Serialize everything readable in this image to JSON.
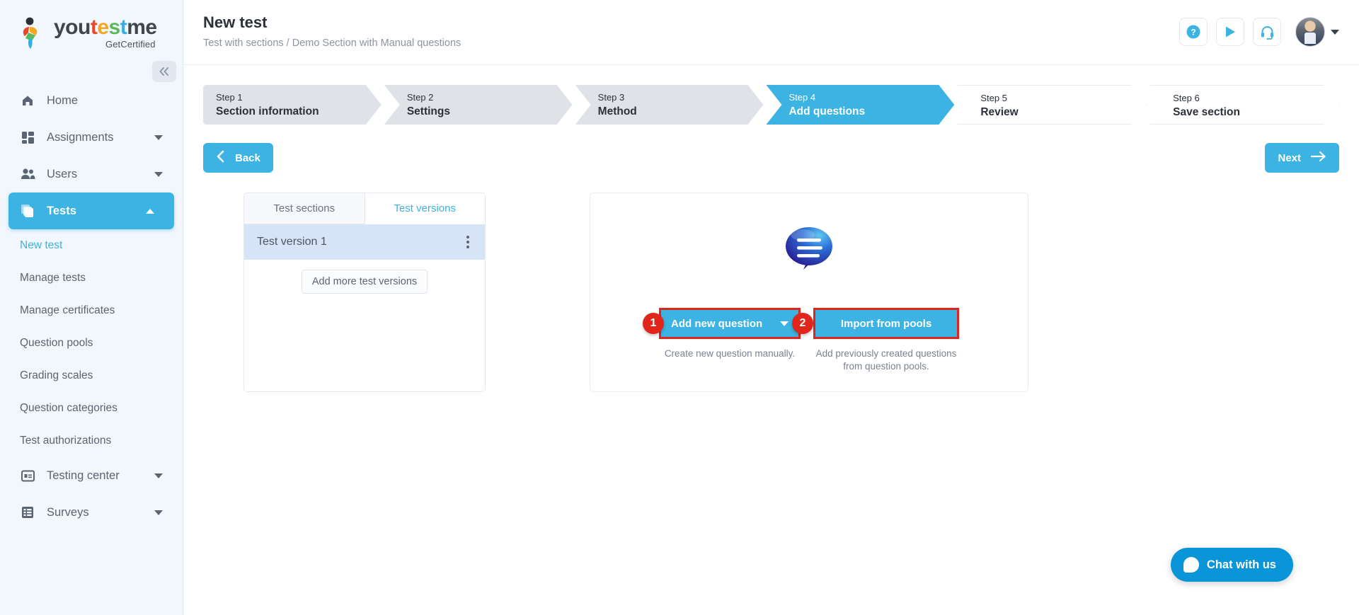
{
  "brand": {
    "name_parts": [
      {
        "t": "you",
        "c": "#3f4650"
      },
      {
        "t": "t",
        "c": "#e8472a"
      },
      {
        "t": "e",
        "c": "#f5a623"
      },
      {
        "t": "s",
        "c": "#5cb85c"
      },
      {
        "t": "t",
        "c": "#35aee0"
      },
      {
        "t": "me",
        "c": "#3f4650"
      }
    ],
    "tagline": "GetCertified",
    "collapse_icon": "chevron-double-left-icon"
  },
  "sidebar": {
    "items": [
      {
        "label": "Home",
        "icon": "home-icon",
        "expandable": false,
        "active": false
      },
      {
        "label": "Assignments",
        "icon": "grid-icon",
        "expandable": true,
        "active": false
      },
      {
        "label": "Users",
        "icon": "users-icon",
        "expandable": true,
        "active": false
      },
      {
        "label": "Tests",
        "icon": "tests-icon",
        "expandable": true,
        "active": true
      }
    ],
    "sub_items": [
      {
        "label": "New test",
        "current": true
      },
      {
        "label": "Manage tests",
        "current": false
      },
      {
        "label": "Manage certificates",
        "current": false
      },
      {
        "label": "Question pools",
        "current": false
      },
      {
        "label": "Grading scales",
        "current": false
      },
      {
        "label": "Question categories",
        "current": false
      },
      {
        "label": "Test authorizations",
        "current": false
      }
    ],
    "bottom_items": [
      {
        "label": "Testing center",
        "icon": "testing-center-icon",
        "expandable": true
      },
      {
        "label": "Surveys",
        "icon": "surveys-icon",
        "expandable": true
      }
    ]
  },
  "header": {
    "title": "New test",
    "breadcrumb": "Test with sections / Demo Section with Manual questions",
    "actions": [
      {
        "name": "help-icon",
        "glyph": "?"
      },
      {
        "name": "play-icon",
        "glyph": "▶"
      },
      {
        "name": "headset-icon",
        "glyph": "☎"
      }
    ],
    "avatar_chevron": "chevron-down-icon"
  },
  "stepper": {
    "steps": [
      {
        "num": "Step 1",
        "name": "Section information",
        "state": "done"
      },
      {
        "num": "Step 2",
        "name": "Settings",
        "state": "done"
      },
      {
        "num": "Step 3",
        "name": "Method",
        "state": "done"
      },
      {
        "num": "Step 4",
        "name": "Add questions",
        "state": "active"
      },
      {
        "num": "Step 5",
        "name": "Review",
        "state": "future"
      },
      {
        "num": "Step 6",
        "name": "Save section",
        "state": "future"
      }
    ]
  },
  "nav_buttons": {
    "back_label": "Back",
    "next_label": "Next"
  },
  "versions_panel": {
    "tabs": [
      {
        "label": "Test sections",
        "active": false
      },
      {
        "label": "Test versions",
        "active": true
      }
    ],
    "rows": [
      {
        "label": "Test version 1"
      }
    ],
    "add_label": "Add more test versions"
  },
  "questions_panel": {
    "illustration": "speech-bubble-icon",
    "add_button_label": "Add new question",
    "add_button_desc": "Create new question manually.",
    "import_button_label": "Import from pools",
    "import_button_desc": "Add previously created questions from question pools.",
    "badges": [
      "1",
      "2"
    ]
  },
  "chat": {
    "label": "Chat with us",
    "icon": "chat-bubble-icon"
  },
  "colors": {
    "accent": "#3cb3e2",
    "sidebar_bg": "#f2f6fd",
    "step_done_bg": "#dfe3e8",
    "highlight_red": "#e1251b",
    "row_selected": "#d7e4f7",
    "chat_blue": "#0a95d9"
  }
}
